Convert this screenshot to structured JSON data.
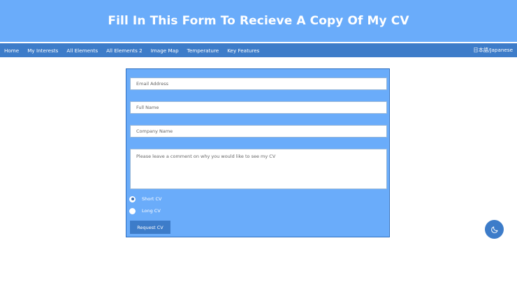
{
  "header": {
    "title": "Fill In This Form To Recieve A Copy Of My CV"
  },
  "nav": {
    "items": [
      {
        "label": "Home"
      },
      {
        "label": "My Interests"
      },
      {
        "label": "All Elements"
      },
      {
        "label": "All Elements 2"
      },
      {
        "label": "Image Map"
      },
      {
        "label": "Temperature"
      },
      {
        "label": "Key Features"
      }
    ],
    "language_label": "日本語/Japanese"
  },
  "form": {
    "email_placeholder": "Email Address",
    "fullname_placeholder": "Full Name",
    "company_placeholder": "Company Name",
    "comment_placeholder": "Please leave a comment on why you would like to see my CV",
    "options": [
      {
        "label": "Short CV",
        "selected": true
      },
      {
        "label": "Long CV",
        "selected": false
      }
    ],
    "submit_label": "Request CV"
  },
  "theme_toggle": {
    "icon": "moon-icon"
  },
  "colors": {
    "header_bg": "#6aacfa",
    "nav_bg": "#3d7cc9",
    "form_bg": "#6aacfa",
    "button_bg": "#3d7cc9"
  }
}
